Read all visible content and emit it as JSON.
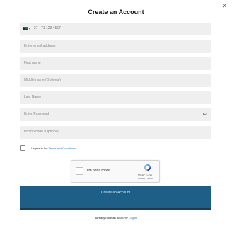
{
  "header": {
    "title": "Create an Account",
    "close_symbol": "✕"
  },
  "phone": {
    "country_code": "+27",
    "number": "71 123 4567",
    "flag": "south-africa-flag"
  },
  "fields": {
    "email_placeholder": "Enter email address",
    "first_name_placeholder": "First name",
    "middle_name_placeholder": "Middle name (Optional)",
    "last_name_placeholder": "Last Name",
    "password_placeholder": "Enter Password",
    "promo_placeholder": "Promo code (Optional)"
  },
  "agreement": {
    "prefix": "I agree to the",
    "link": "Terms and Conditions",
    "checked": false
  },
  "captcha": {
    "label": "I'm not a robot",
    "brand": "reCAPTCHA",
    "links": "Privacy - Terms",
    "checked": false
  },
  "submit": {
    "label": "Create an Account",
    "color": "#1d5f87"
  },
  "footer": {
    "prompt": "Already have an account?",
    "link": "Log In"
  },
  "colors": {
    "field_bg": "#efefef",
    "link": "#1a73c8",
    "button": "#1d5f87"
  }
}
